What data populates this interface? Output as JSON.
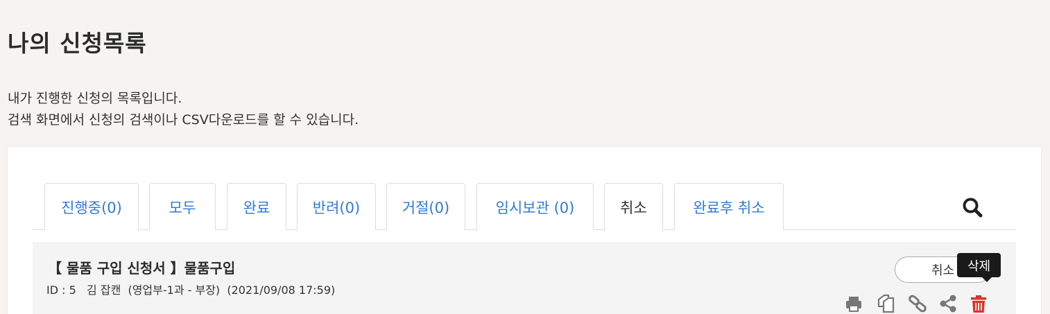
{
  "page": {
    "title": "나의 신청목록",
    "description_line1": "내가 진행한 신청의 목록입니다.",
    "description_line2": "검색 화면에서 신청의 검색이나 CSV다운로드를 할 수 있습니다."
  },
  "tabs": [
    {
      "label": "진행중(0)",
      "active": false
    },
    {
      "label": "모두",
      "active": false
    },
    {
      "label": "완료",
      "active": false
    },
    {
      "label": "반려(0)",
      "active": false
    },
    {
      "label": "거절(0)",
      "active": false
    },
    {
      "label": "임시보관 (0)",
      "active": false
    },
    {
      "label": "취소",
      "active": true
    },
    {
      "label": "완료후 취소",
      "active": false
    }
  ],
  "icons": {
    "search": "search-icon",
    "print": "print-icon",
    "copy": "copy-icon",
    "link": "link-icon",
    "share": "share-icon",
    "delete": "trash-icon"
  },
  "colors": {
    "tab_link": "#2f7ad5",
    "delete": "#d9342b",
    "icon_gray": "#777777"
  },
  "request": {
    "title": "【 물품 구입 신청서 】물품구입",
    "id_label": "ID : 5",
    "applicant": "김 잡캔",
    "department": "(영업부-1과 - 부장)",
    "datetime": "(2021/09/08 17:59)",
    "status": "취소",
    "tooltip": "삭제"
  }
}
